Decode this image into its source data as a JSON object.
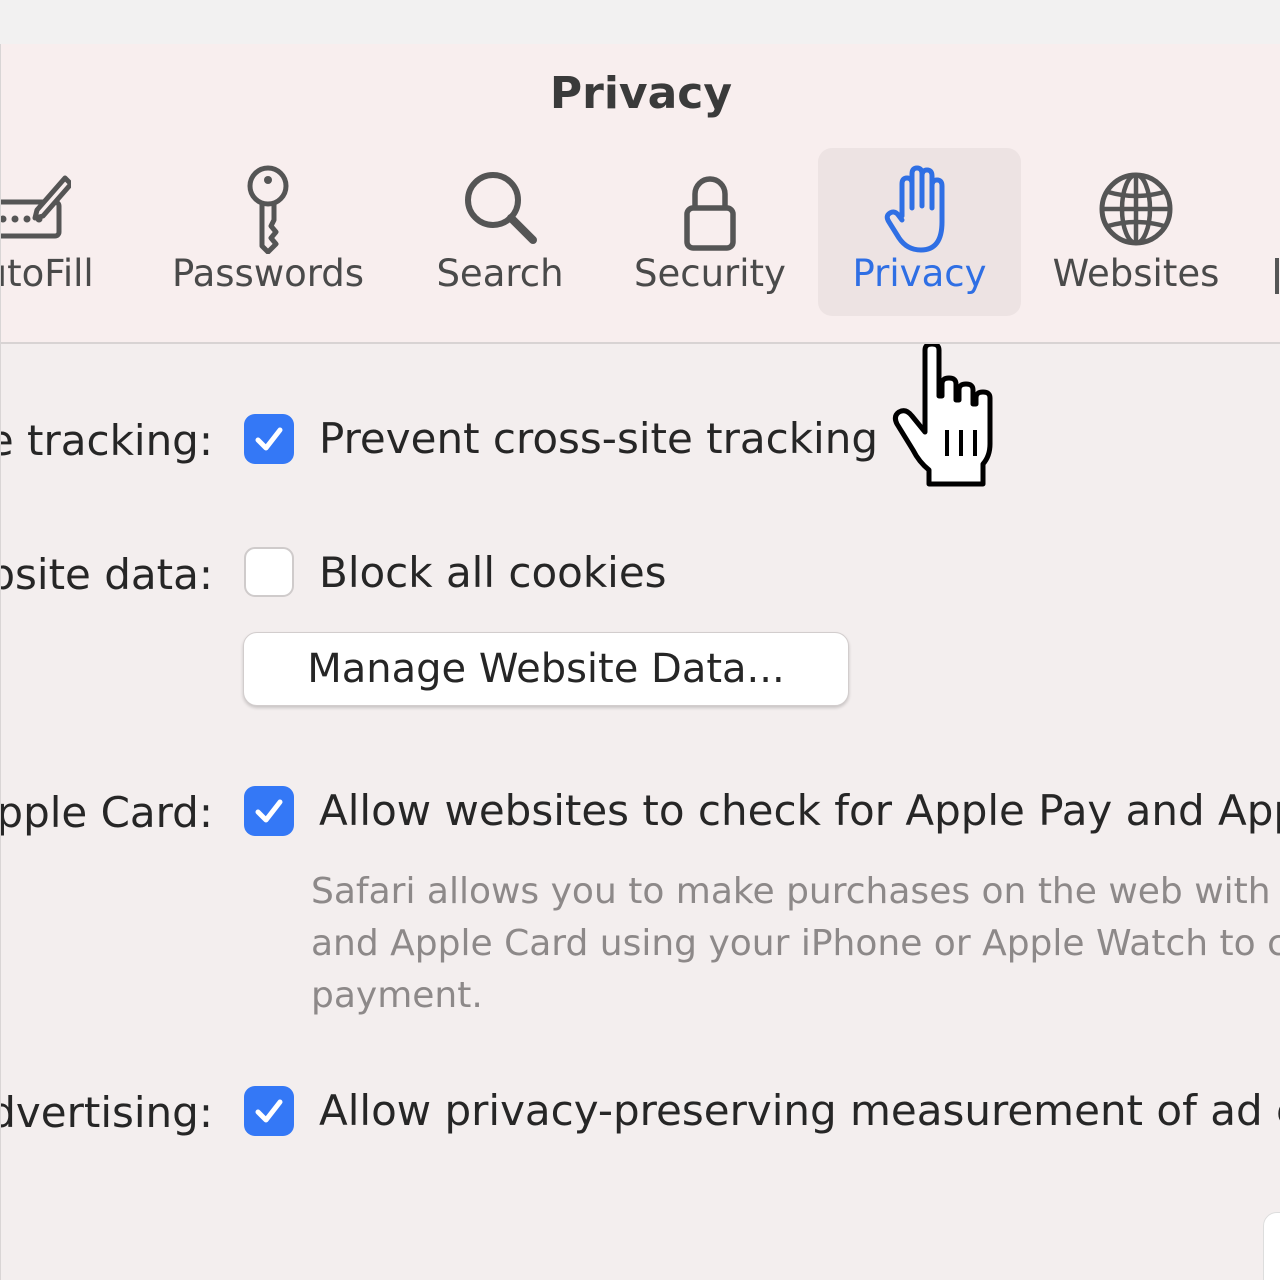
{
  "window": {
    "title": "Privacy"
  },
  "toolbar": {
    "tabs": [
      {
        "label": "AutoFill",
        "icon": "autofill-icon"
      },
      {
        "label": "Passwords",
        "icon": "key-icon"
      },
      {
        "label": "Search",
        "icon": "magnifier-icon"
      },
      {
        "label": "Security",
        "icon": "lock-icon"
      },
      {
        "label": "Privacy",
        "icon": "hand-icon",
        "selected": true
      },
      {
        "label": "Websites",
        "icon": "globe-icon"
      }
    ]
  },
  "settings": {
    "tracking": {
      "label": "Website tracking:",
      "option": "Prevent cross-site tracking",
      "checked": true
    },
    "cookies": {
      "label": "Cookies and website data:",
      "option": "Block all cookies",
      "checked": false,
      "button": "Manage Website Data..."
    },
    "apple_pay": {
      "label": "Apple Pay and Apple Card:",
      "option": "Allow websites to check for Apple Pay and Apple Card",
      "checked": true,
      "description_lines": [
        "Safari allows you to make purchases on the web with Apple Pay",
        "and Apple Card using your iPhone or Apple Watch to confirm",
        "payment."
      ]
    },
    "advertising": {
      "label": "Web advertising:",
      "option": "Allow privacy-preserving measurement of ad effectiveness",
      "checked": true
    }
  },
  "colors": {
    "accent": "#3478f6",
    "selected_label": "#2f6fe4",
    "toolbar_bg": "#f8eeee",
    "content_bg": "#f3eeee"
  }
}
